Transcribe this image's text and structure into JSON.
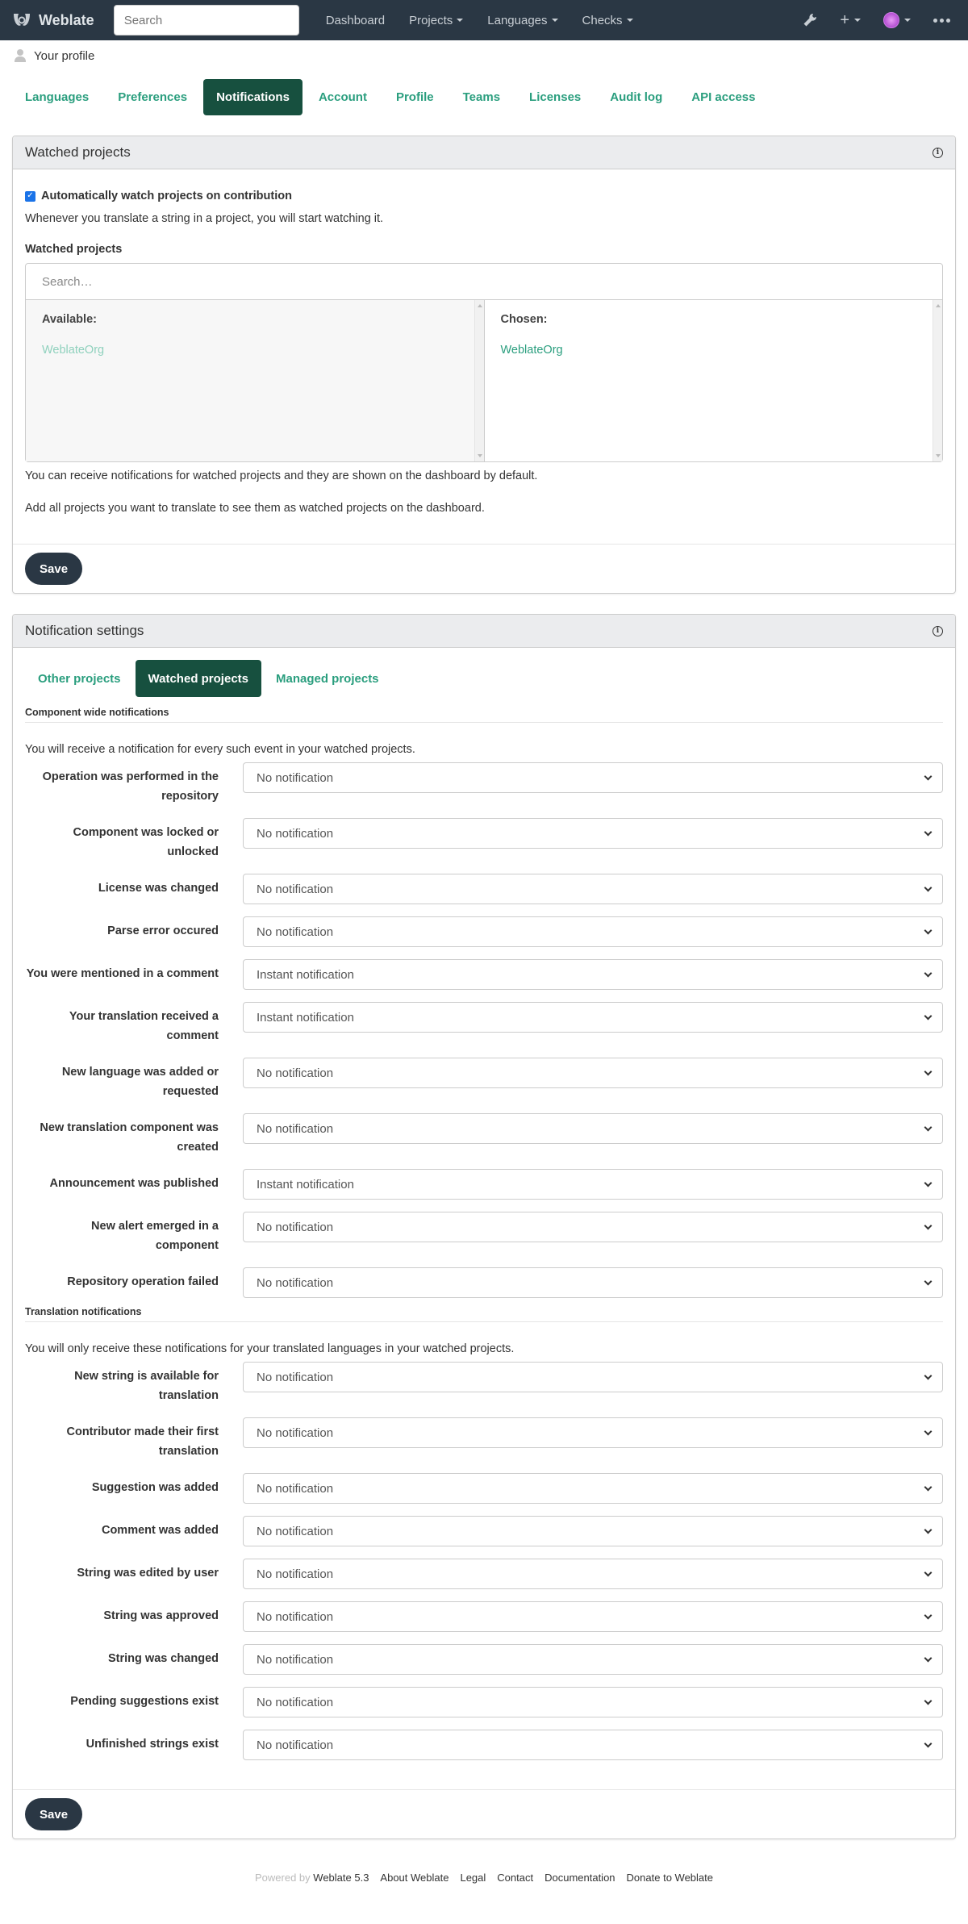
{
  "navbar": {
    "brand": "Weblate",
    "search_placeholder": "Search",
    "links": [
      {
        "label": "Dashboard",
        "dropdown": false
      },
      {
        "label": "Projects",
        "dropdown": true
      },
      {
        "label": "Languages",
        "dropdown": true
      },
      {
        "label": "Checks",
        "dropdown": true
      }
    ],
    "icons": [
      "wrench-icon",
      "plus-icon",
      "avatar",
      "more-icon"
    ]
  },
  "breadcrumb": {
    "label": "Your profile"
  },
  "profile_tabs": [
    {
      "label": "Languages",
      "active": false
    },
    {
      "label": "Preferences",
      "active": false
    },
    {
      "label": "Notifications",
      "active": true
    },
    {
      "label": "Account",
      "active": false
    },
    {
      "label": "Profile",
      "active": false
    },
    {
      "label": "Teams",
      "active": false
    },
    {
      "label": "Licenses",
      "active": false
    },
    {
      "label": "Audit log",
      "active": false
    },
    {
      "label": "API access",
      "active": false
    }
  ],
  "watched": {
    "title": "Watched projects",
    "auto_watch_label": "Automatically watch projects on contribution",
    "auto_watch_checked": true,
    "auto_watch_help": "Whenever you translate a string in a project, you will start watching it.",
    "field_label": "Watched projects",
    "search_placeholder": "Search…",
    "available_label": "Available:",
    "available_items": [
      "WeblateOrg"
    ],
    "chosen_label": "Chosen:",
    "chosen_items": [
      "WeblateOrg"
    ],
    "help1": "You can receive notifications for watched projects and they are shown on the dashboard by default.",
    "help2": "Add all projects you want to translate to see them as watched projects on the dashboard.",
    "save_label": "Save"
  },
  "notifications": {
    "title": "Notification settings",
    "tabs": [
      {
        "label": "Other projects",
        "active": false
      },
      {
        "label": "Watched projects",
        "active": true
      },
      {
        "label": "Managed projects",
        "active": false
      }
    ],
    "component_legend": "Component wide notifications",
    "component_help": "You will receive a notification for every such event in your watched projects.",
    "component_rows": [
      {
        "label": "Operation was performed in the repository",
        "value": "No notification"
      },
      {
        "label": "Component was locked or unlocked",
        "value": "No notification"
      },
      {
        "label": "License was changed",
        "value": "No notification"
      },
      {
        "label": "Parse error occured",
        "value": "No notification"
      },
      {
        "label": "You were mentioned in a comment",
        "value": "Instant notification"
      },
      {
        "label": "Your translation received a comment",
        "value": "Instant notification"
      },
      {
        "label": "New language was added or requested",
        "value": "No notification"
      },
      {
        "label": "New translation component was created",
        "value": "No notification"
      },
      {
        "label": "Announcement was published",
        "value": "Instant notification"
      },
      {
        "label": "New alert emerged in a component",
        "value": "No notification"
      },
      {
        "label": "Repository operation failed",
        "value": "No notification"
      }
    ],
    "translation_legend": "Translation notifications",
    "translation_help": "You will only receive these notifications for your translated languages in your watched projects.",
    "translation_rows": [
      {
        "label": "New string is available for translation",
        "value": "No notification"
      },
      {
        "label": "Contributor made their first translation",
        "value": "No notification"
      },
      {
        "label": "Suggestion was added",
        "value": "No notification"
      },
      {
        "label": "Comment was added",
        "value": "No notification"
      },
      {
        "label": "String was edited by user",
        "value": "No notification"
      },
      {
        "label": "String was approved",
        "value": "No notification"
      },
      {
        "label": "String was changed",
        "value": "No notification"
      },
      {
        "label": "Pending suggestions exist",
        "value": "No notification"
      },
      {
        "label": "Unfinished strings exist",
        "value": "No notification"
      }
    ],
    "save_label": "Save"
  },
  "footer": {
    "powered_by": "Powered by",
    "links": [
      "Weblate 5.3",
      "About Weblate",
      "Legal",
      "Contact",
      "Documentation",
      "Donate to Weblate"
    ]
  }
}
